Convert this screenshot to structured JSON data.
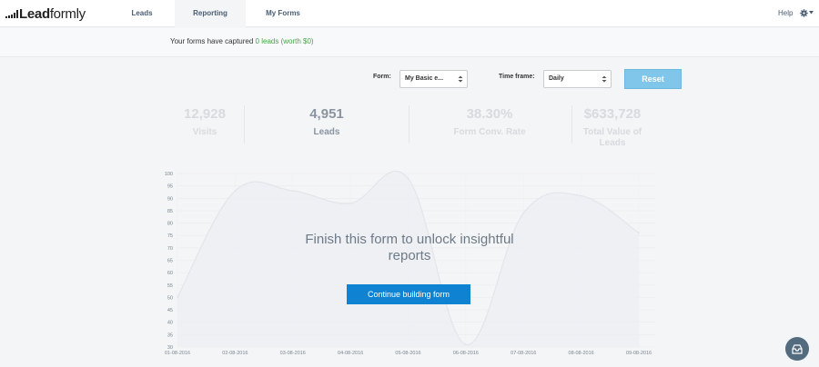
{
  "brand": {
    "logo_bold": "Lead",
    "logo_light": "formly"
  },
  "nav": {
    "tabs": [
      {
        "label": "Leads",
        "active": false
      },
      {
        "label": "Reporting",
        "active": true
      },
      {
        "label": "My Forms",
        "active": false
      }
    ],
    "help_label": "Help",
    "settings_icon": "gear-icon"
  },
  "banner": {
    "prefix": "Your forms have captured",
    "highlight": "0 leads (worth $0)",
    "highlight_color": "#47a447"
  },
  "filters": {
    "form_label": "Form:",
    "form_value": "My Basic e...",
    "timeframe_label": "Time frame:",
    "timeframe_value": "Daily",
    "reset_label": "Reset"
  },
  "stats": [
    {
      "value": "12,928",
      "label": "Visits"
    },
    {
      "value": "4,951",
      "label": "Leads",
      "active": true
    },
    {
      "value": "38.30%",
      "label": "Form Conv. Rate"
    },
    {
      "value": "$633,728",
      "label": "Total Value of Leads"
    }
  ],
  "chart_data": {
    "type": "area",
    "x": [
      "01-08-2016",
      "02-08-2016",
      "03-08-2016",
      "04-08-2016",
      "05-08-2016",
      "06-08-2016",
      "07-08-2016",
      "08-08-2016",
      "09-08-2016"
    ],
    "series": [
      {
        "values": [
          50,
          93,
          93,
          88,
          98,
          31,
          84,
          91,
          76
        ]
      }
    ],
    "yticks": [
      30,
      35,
      40,
      45,
      50,
      55,
      60,
      65,
      70,
      75,
      80,
      85,
      90,
      95,
      100
    ],
    "ylim": [
      30,
      100
    ],
    "grid": true
  },
  "overlay": {
    "message": "Finish this form to unlock insightful reports",
    "button_label": "Continue building form"
  },
  "chat": {
    "icon": "inbox-icon"
  }
}
